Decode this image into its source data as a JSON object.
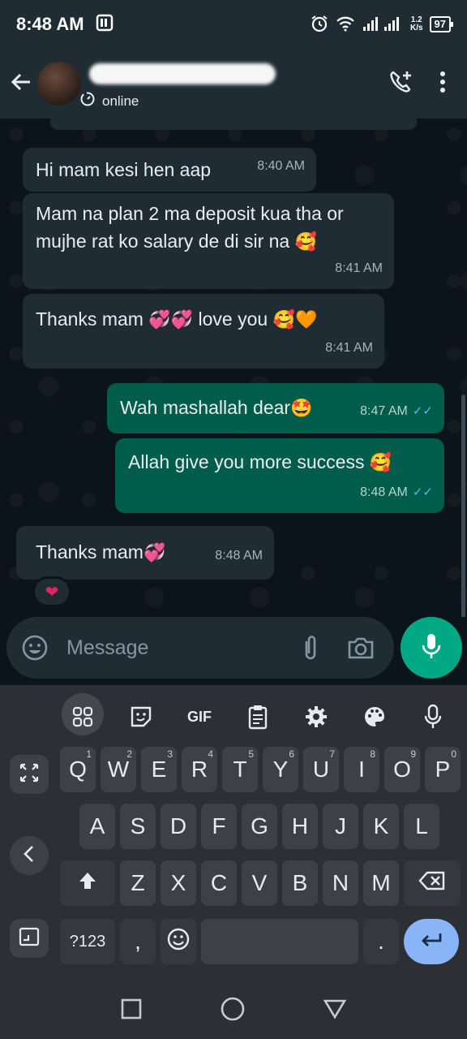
{
  "status_bar": {
    "time": "8:48 AM",
    "net_speed_value": "1.2",
    "net_speed_unit": "K/s",
    "battery_level": "97",
    "icons": [
      "notification-icon",
      "alarm-icon",
      "wifi-icon",
      "signal-icon"
    ]
  },
  "header": {
    "contact_status": "online",
    "icons": [
      "back-arrow-icon",
      "add-call-icon",
      "more-options-icon"
    ]
  },
  "messages": [
    {
      "direction": "in",
      "text": "Hi mam kesi hen aap",
      "emoji": "",
      "time": "8:40 AM"
    },
    {
      "direction": "in",
      "text": "Mam na plan 2 ma deposit kua tha or mujhe rat ko salary de di sir na",
      "emoji": "🥰",
      "time": "8:41 AM"
    },
    {
      "direction": "in",
      "text": "Thanks mam",
      "emoji_mid": "💞💞",
      "text2": "love you",
      "emoji": "🥰🧡",
      "time": "8:41 AM"
    },
    {
      "direction": "out",
      "text": "Wah mashallah dear",
      "emoji": "🤩",
      "time": "8:47 AM",
      "ticks": "✓✓"
    },
    {
      "direction": "out",
      "text": "Allah give you more success",
      "emoji": "🥰",
      "time": "8:48 AM",
      "ticks": "✓✓"
    },
    {
      "direction": "in",
      "text": "Thanks mam",
      "emoji": "💞",
      "time": "8:48 AM",
      "reaction": "❤"
    }
  ],
  "composer": {
    "placeholder": "Message",
    "icons": [
      "emoji-icon",
      "attach-icon",
      "camera-icon",
      "mic-icon"
    ]
  },
  "keyboard": {
    "toolbar": {
      "gif_label": "GIF"
    },
    "row1": [
      {
        "key": "Q",
        "hint": "1"
      },
      {
        "key": "W",
        "hint": "2"
      },
      {
        "key": "E",
        "hint": "3"
      },
      {
        "key": "R",
        "hint": "4"
      },
      {
        "key": "T",
        "hint": "5"
      },
      {
        "key": "Y",
        "hint": "6"
      },
      {
        "key": "U",
        "hint": "7"
      },
      {
        "key": "I",
        "hint": "8"
      },
      {
        "key": "O",
        "hint": "9"
      },
      {
        "key": "P",
        "hint": "0"
      }
    ],
    "row2": [
      "A",
      "S",
      "D",
      "F",
      "G",
      "H",
      "J",
      "K",
      "L"
    ],
    "row3": [
      "Z",
      "X",
      "C",
      "V",
      "B",
      "N",
      "M"
    ],
    "symbols_label": "?123",
    "comma_label": ",",
    "period_label": "."
  },
  "colors": {
    "chat_bg": "#0b141a",
    "incoming_bubble": "#1f2c34",
    "outgoing_bubble": "#005c4b",
    "accent": "#00a884",
    "read_ticks": "#53bdeb"
  }
}
